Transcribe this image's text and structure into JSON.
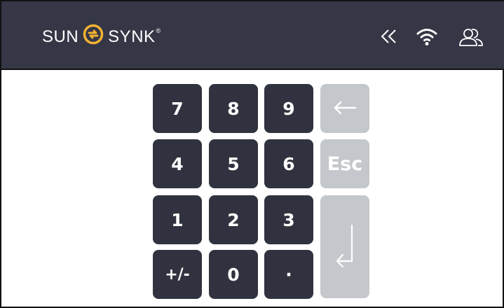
{
  "header": {
    "brand_left": "SUN",
    "brand_right": "SYNK",
    "brand_reg": "®",
    "icons": [
      "back-double-chevron-icon",
      "wifi-icon",
      "users-icon"
    ]
  },
  "keypad": {
    "digits": [
      "7",
      "8",
      "9",
      "4",
      "5",
      "6",
      "1",
      "2",
      "3"
    ],
    "plus_minus": "+/-",
    "zero": "0",
    "dot": "·",
    "esc": "Esc",
    "backspace_icon": "left-arrow-icon",
    "enter_icon": "enter-icon"
  },
  "colors": {
    "header_bg": "#353746",
    "key_dark": "#30333f",
    "key_gray": "#c4c7cc",
    "logo_accent": "#f2b233"
  }
}
